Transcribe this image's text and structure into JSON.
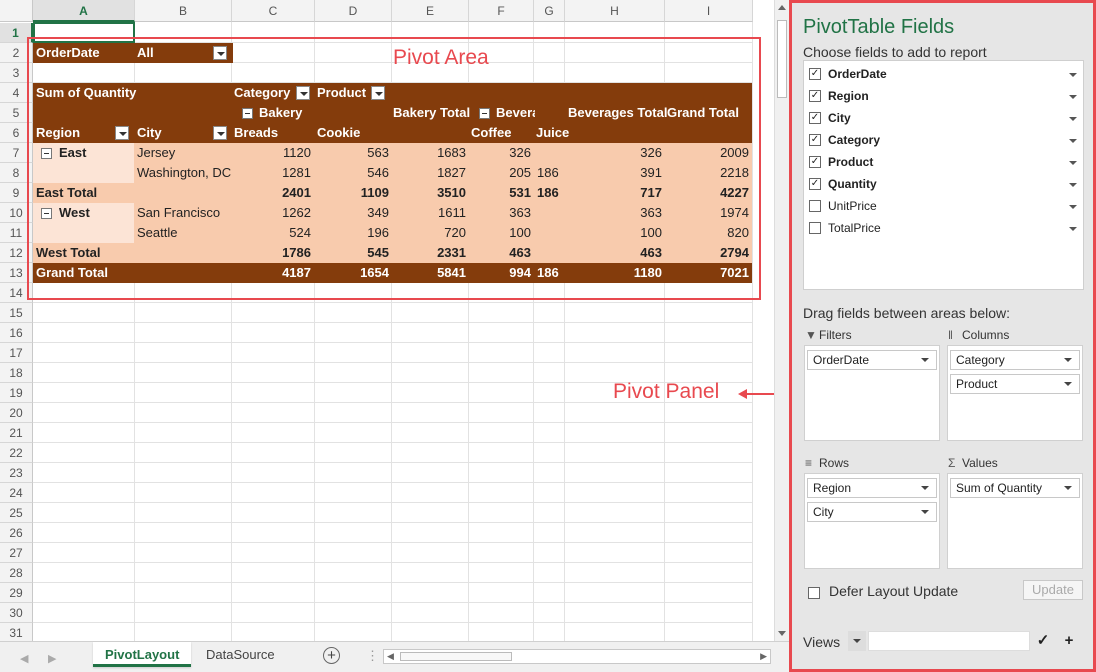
{
  "columns": [
    "A",
    "B",
    "C",
    "D",
    "E",
    "F",
    "G",
    "H",
    "I"
  ],
  "rows": [
    "1",
    "2",
    "3",
    "4",
    "5",
    "6",
    "7",
    "8",
    "9",
    "10",
    "11",
    "12",
    "13",
    "14",
    "15",
    "16",
    "17",
    "18",
    "19",
    "20",
    "21",
    "22",
    "23",
    "24",
    "25",
    "26",
    "27",
    "28",
    "29",
    "30",
    "31"
  ],
  "pivot": {
    "filter_field": "OrderDate",
    "filter_value": "All",
    "sum_label": "Sum of Quantity",
    "category_label": "Category",
    "product_label": "Product",
    "bakery": "Bakery",
    "bakery_total": "Bakery Total",
    "beverages": "Bevera",
    "beverages_total": "Beverages Total",
    "grand_total_hdr": "Grand Total",
    "region": "Region",
    "city": "City",
    "breads": "Breads",
    "cookie": "Cookie",
    "coffee": "Coffee",
    "juice": "Juice",
    "east": "East",
    "west": "West",
    "jersey": "Jersey",
    "washington": "Washington, DC",
    "sanfrancisco": "San Francisco",
    "seattle": "Seattle",
    "east_total": "East Total",
    "west_total": "West Total",
    "grand_total": "Grand Total",
    "r7": [
      "1120",
      "563",
      "1683",
      "326",
      "",
      "326",
      "2009"
    ],
    "r8": [
      "1281",
      "546",
      "1827",
      "205",
      "186",
      "391",
      "2218"
    ],
    "r9": [
      "2401",
      "1109",
      "3510",
      "531",
      "186",
      "717",
      "4227"
    ],
    "r10": [
      "1262",
      "349",
      "1611",
      "363",
      "",
      "363",
      "1974"
    ],
    "r11": [
      "524",
      "196",
      "720",
      "100",
      "",
      "100",
      "820"
    ],
    "r12": [
      "1786",
      "545",
      "2331",
      "463",
      "",
      "463",
      "2794"
    ],
    "r13": [
      "4187",
      "1654",
      "5841",
      "994",
      "186",
      "1180",
      "7021"
    ]
  },
  "annotations": {
    "pivot_area": "Pivot Area",
    "pivot_panel": "Pivot Panel"
  },
  "tabs": [
    "PivotLayout",
    "DataSource"
  ],
  "panel": {
    "title": "PivotTable Fields",
    "subtitle": "Choose fields to add to report",
    "fields": [
      {
        "label": "OrderDate",
        "checked": true
      },
      {
        "label": "Region",
        "checked": true
      },
      {
        "label": "City",
        "checked": true
      },
      {
        "label": "Category",
        "checked": true
      },
      {
        "label": "Product",
        "checked": true
      },
      {
        "label": "Quantity",
        "checked": true
      },
      {
        "label": "UnitPrice",
        "checked": false
      },
      {
        "label": "TotalPrice",
        "checked": false
      }
    ],
    "drag_text": "Drag fields between areas below:",
    "filters_label": "Filters",
    "columns_label": "Columns",
    "rows_label": "Rows",
    "values_label": "Values",
    "filters_items": [
      "OrderDate"
    ],
    "columns_items": [
      "Category",
      "Product"
    ],
    "rows_items": [
      "Region",
      "City"
    ],
    "values_items": [
      "Sum of Quantity"
    ],
    "defer_label": "Defer Layout Update",
    "update_label": "Update",
    "views_label": "Views",
    "check_symbol": "✓",
    "plus_symbol": "+"
  },
  "colors": {
    "brown": "#843c0c",
    "peach": "#f8cbad",
    "green": "#217346",
    "annotation": "#e8494f"
  }
}
